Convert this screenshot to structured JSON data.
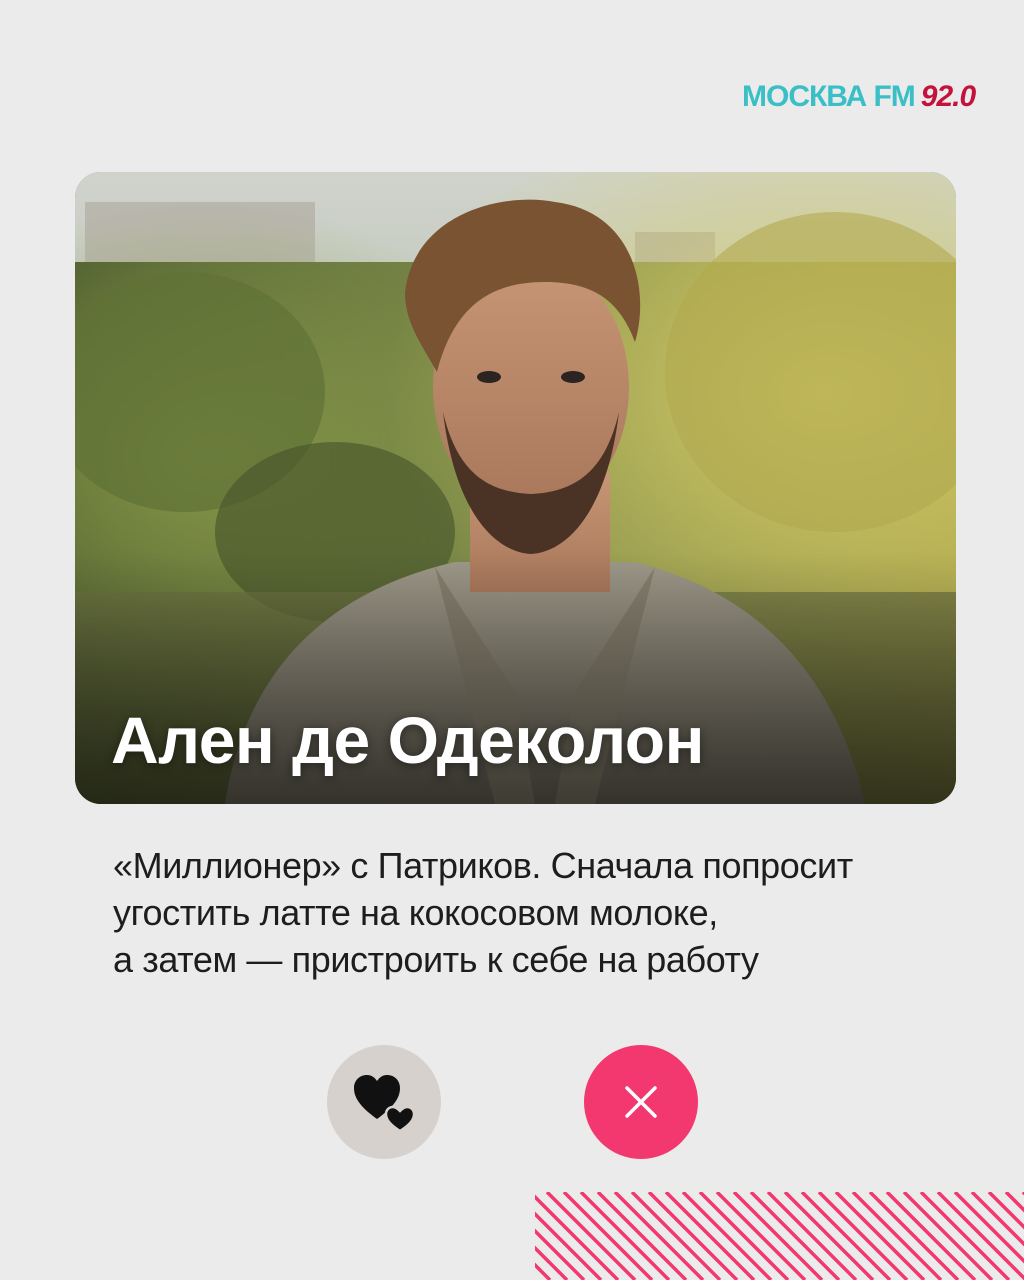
{
  "logo": {
    "brand_text": "МОСКВА FM",
    "frequency": "92.0",
    "brand_color": "#3bbfc6",
    "frequency_color": "#c4123c"
  },
  "card": {
    "name": "Ален де Одеколон",
    "photo_description_icon": "man-portrait-photo"
  },
  "description": {
    "lines": [
      "«Миллионер» с Патриков. Сначала попросит",
      "угостить латте на кокосовом молоке,",
      "а затем — пристроить к себе на работу"
    ]
  },
  "actions": {
    "like_icon": "two-hearts-icon",
    "dismiss_icon": "close-icon",
    "like_bg": "#d6d1cd",
    "dismiss_bg": "#f2386f"
  },
  "decor": {
    "stripe_color": "#f2386f"
  }
}
